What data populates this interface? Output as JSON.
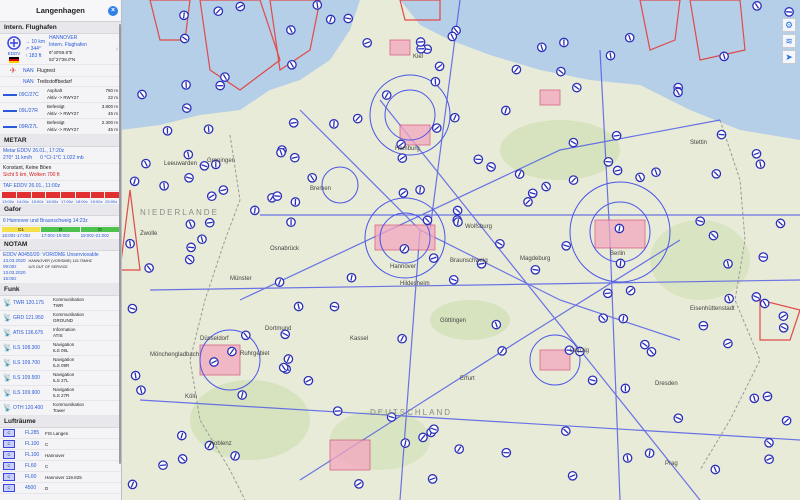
{
  "panel": {
    "title": "Langenhagen",
    "close_glyph": "×",
    "section_airport": "Intern. Flughafen",
    "airport_code": "EDDV",
    "airport_distance": "→ 10 km",
    "airport_city": "HANNOVER",
    "airport_type": "Intern. Flughafen",
    "airport_elev": "↗ 344°",
    "airport_lat": "9°40'59.8\"E",
    "airport_dist2": "↑ 183 ft",
    "airport_lon": "52°27'38.0\"N",
    "nan1": "NAN",
    "nan1_text": "Flugrest",
    "nan2": "NAN",
    "nan2_text": "Treibstoffbedarf",
    "runways": [
      {
        "name": "09C/27C",
        "surface": "Asphalt",
        "length": "780 m",
        "status": "Aktiv -> RWY27",
        "width": "22 m"
      },
      {
        "name": "09L/27R",
        "surface": "Befestigt",
        "length": "3.800 m",
        "status": "Aktiv -> RWY27",
        "width": "45 m"
      },
      {
        "name": "09R/27L",
        "surface": "Befestigt",
        "length": "2.300 m",
        "status": "Aktiv -> RWY27",
        "width": "45 m"
      }
    ],
    "section_metar": "METAR",
    "metar_line1": "Metar EDDV   26.01., 17:20z",
    "metar_wind": "270° 11 km/h",
    "metar_temp": "0 °C/-1°C 1.022 mb",
    "metar_warn1": "Konstant, Keine Böen",
    "metar_warn2": "Sicht 5 km, Wolken 700 ft",
    "taf_line": "TAF EDDV   26.01., 11:00z",
    "taf_times": [
      "13:00z",
      "14:00z",
      "15:00z",
      "16:00z",
      "17:00z",
      "18:00z",
      "19:00z",
      "20:00z"
    ],
    "section_gafor": "Gafor",
    "gafor_region": "6 Hannover und Braunschweig 14:23z",
    "gafor_codes": [
      "D1",
      "O",
      "O"
    ],
    "gafor_times": [
      "15:00z-17:00z",
      "17:00z-19:00z",
      "19:00z-21:00z"
    ],
    "section_notam": "NOTAM",
    "notam_id": "EDDV A0450/20: VOR/DME Unserviceable",
    "notam_date1": "13.03.2020",
    "notam_date1b": "09:00z",
    "notam_text1": "HANNOVER (VOR/DME) 115.75MHZ",
    "notam_text1b": "U/S OUT OF SERVICE",
    "notam_date2": "13.03.2020",
    "notam_date2b": "15:00z",
    "section_funk": "Funk",
    "funk": [
      {
        "freq": "TWR 120.175",
        "type": "Kommunikation",
        "name": "TWR"
      },
      {
        "freq": "GRD 121.950",
        "type": "Kommunikation",
        "name": "GROUND"
      },
      {
        "freq": "ATIS 136.675",
        "type": "Information",
        "name": "ATIS"
      },
      {
        "freq": "ILS 108.300",
        "type": "Navigation",
        "name": "ILS 09L"
      },
      {
        "freq": "ILS 109.700",
        "type": "Navigation",
        "name": "ILS 09R"
      },
      {
        "freq": "ILS 109.500",
        "type": "Navigation",
        "name": "ILS 27L"
      },
      {
        "freq": "ILS 109.900",
        "type": "Navigation",
        "name": "ILS 27R"
      },
      {
        "freq": "OTH 120.400",
        "type": "Kommunikation",
        "name": "Tower"
      }
    ],
    "section_luftraeume": "Lufträume",
    "luftraeume": [
      {
        "class": "C",
        "fl": "FL285",
        "name": "FIS Langen"
      },
      {
        "class": "C",
        "fl": "FL100",
        "name": "C"
      },
      {
        "class": "C",
        "fl": "FL100",
        "name": "Hannover"
      },
      {
        "class": "C",
        "fl": "FL60",
        "name": "C"
      },
      {
        "class": "C",
        "fl": "FL60",
        "name": "Hannover 119.825"
      },
      {
        "class": "C",
        "fl": "4500",
        "name": "D"
      }
    ]
  },
  "map": {
    "cities": [
      "Kiel",
      "Stettin",
      "Groningen",
      "Leeuwarden",
      "Bremen",
      "Hamburg",
      "Berlin",
      "Hannover",
      "Wolfsburg",
      "Göttingen",
      "Leipzig",
      "Dresden",
      "Erfurt",
      "Kassel",
      "Osnabrück",
      "Münster",
      "Dortmund",
      "Düsseldorf",
      "Mönchengladbach",
      "Köln",
      "Koblenz",
      "Prag",
      "Zwolle",
      "Ruhrgebiet",
      "Eisenhüttenstadt",
      "Braunschweig",
      "Hildesheim",
      "Magdeburg"
    ],
    "country_labels": [
      "NIEDERLANDE",
      "DEUTSCHLAND"
    ],
    "buttons": [
      "layers-icon",
      "gear-icon",
      "locate-icon"
    ],
    "colors": {
      "airspace_blue": "#3b45e0",
      "restricted_red": "#e04a4a",
      "land": "#e8ebd7",
      "sea": "#a9c8e6"
    }
  }
}
